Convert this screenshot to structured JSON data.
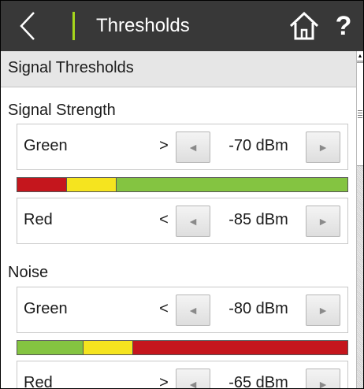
{
  "header": {
    "title": "Thresholds",
    "back_icon": "chevron-left-icon",
    "home_icon": "home-icon",
    "help_label": "?",
    "accent_color": "#a6d71b"
  },
  "section": {
    "title": "Signal Thresholds"
  },
  "signal_strength": {
    "label": "Signal Strength",
    "green": {
      "label": "Green",
      "operator": ">",
      "value": "-70 dBm"
    },
    "red": {
      "label": "Red",
      "operator": "<",
      "value": "-85 dBm"
    },
    "bar_segments": [
      {
        "color": "#c5161d",
        "fraction": 0.15
      },
      {
        "color": "#f5e41f",
        "fraction": 0.15
      },
      {
        "color": "#84c441",
        "fraction": 0.7
      }
    ]
  },
  "noise": {
    "label": "Noise",
    "green": {
      "label": "Green",
      "operator": "<",
      "value": "-80 dBm"
    },
    "red": {
      "label": "Red",
      "operator": ">",
      "value": "-65 dBm"
    },
    "bar_segments": [
      {
        "color": "#84c441",
        "fraction": 0.2
      },
      {
        "color": "#f5e41f",
        "fraction": 0.15
      },
      {
        "color": "#c5161d",
        "fraction": 0.65
      }
    ]
  },
  "stepper": {
    "decrement_glyph": "◄",
    "increment_glyph": "►"
  },
  "colors": {
    "topbar": "#383838",
    "red": "#c5161d",
    "yellow": "#f5e41f",
    "green": "#84c441"
  }
}
